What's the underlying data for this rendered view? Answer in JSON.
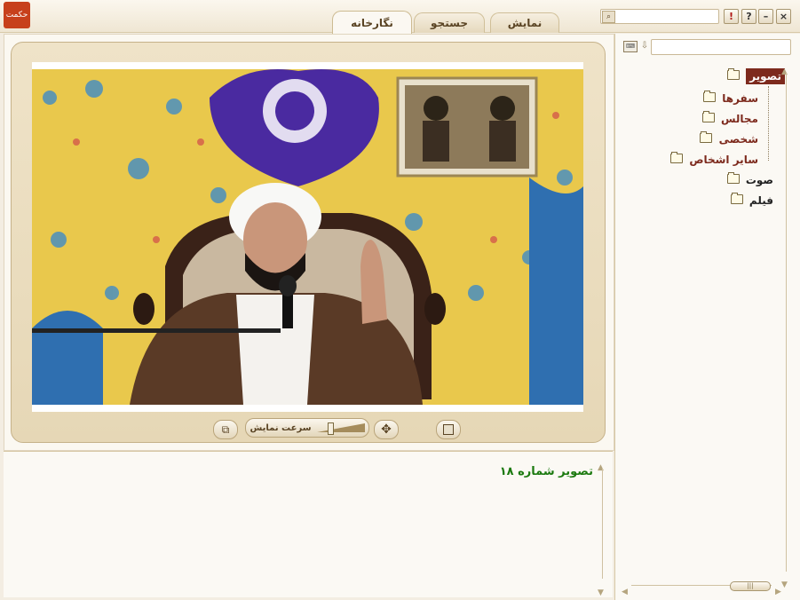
{
  "app": {
    "logo_text": "حکمت"
  },
  "tabs": [
    {
      "label": "نمایش"
    },
    {
      "label": "جستجو"
    },
    {
      "label": "نگارخانه"
    }
  ],
  "window_buttons": {
    "alert": "!",
    "help": "?",
    "minimize": "–",
    "close": "×"
  },
  "toolbar": {
    "speed_label": "سرعت نمایش",
    "speed_value_fraction": 0.25
  },
  "caption": {
    "text": "تصویر شماره ۱۸"
  },
  "tree": {
    "root": {
      "label": "تصویر"
    },
    "children": [
      {
        "label": "سفرها"
      },
      {
        "label": "مجالس"
      },
      {
        "label": "شخصی"
      },
      {
        "label": "سایر اشخاص"
      }
    ],
    "siblings": [
      {
        "label": "صوت"
      },
      {
        "label": "فیلم"
      }
    ]
  },
  "colors": {
    "accent": "#7d2a1d",
    "caption_green": "#1c7a10",
    "frame": "#e6d7b6"
  }
}
